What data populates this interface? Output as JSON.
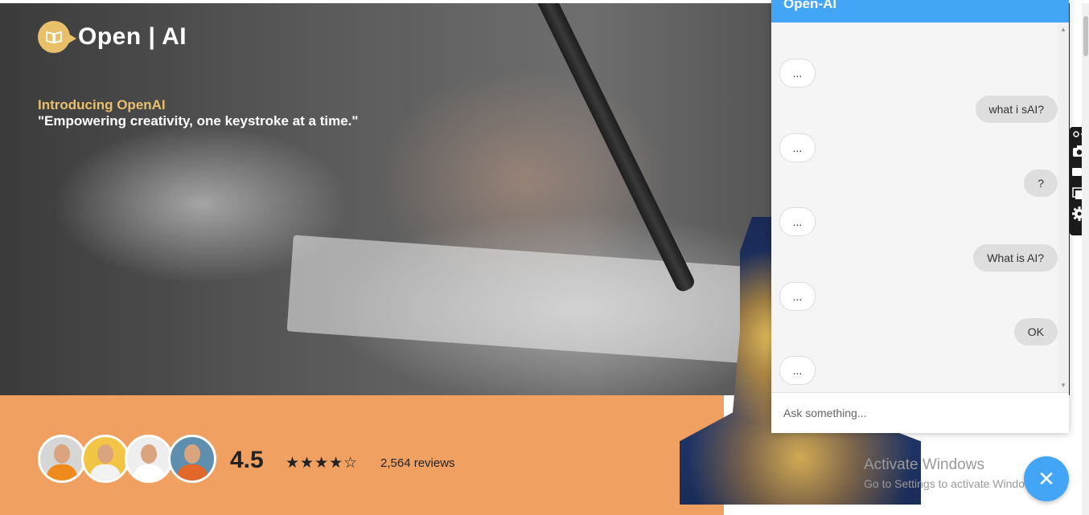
{
  "brand": {
    "name": "Open | AI"
  },
  "hero": {
    "intro_title": "Introducing OpenAI",
    "intro_quote": "\"Empowering creativity, one keystroke at a time.\""
  },
  "social_proof": {
    "rating": "4.5",
    "stars_text": "★★★★☆",
    "stars_value": 4,
    "stars_max": 5,
    "reviews": "2,564 reviews"
  },
  "chat": {
    "title": "Open-AI",
    "messages": [
      {
        "role": "bot",
        "text": "..."
      },
      {
        "role": "user",
        "text": "what i sAI?"
      },
      {
        "role": "bot",
        "text": "..."
      },
      {
        "role": "user",
        "text": "?"
      },
      {
        "role": "bot",
        "text": "..."
      },
      {
        "role": "user",
        "text": "What is AI?"
      },
      {
        "role": "bot",
        "text": "..."
      },
      {
        "role": "user",
        "text": "OK"
      },
      {
        "role": "bot",
        "text": "..."
      }
    ],
    "input_placeholder": "Ask something...",
    "close_label": "✕"
  },
  "watermark": {
    "title": "Activate Windows",
    "subtitle": "Go to Settings to activate Windows."
  },
  "colors": {
    "accent": "#42a5f5",
    "brand_gold": "#e8c06a",
    "band_orange": "#f0a162"
  }
}
